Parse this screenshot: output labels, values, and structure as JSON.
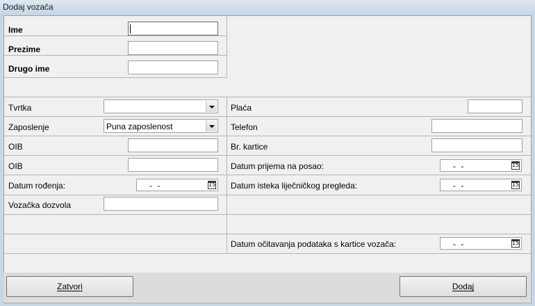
{
  "window": {
    "title": "Dodaj vozača"
  },
  "personal": {
    "ime_label": "Ime",
    "prezime_label": "Prezime",
    "drugo_ime_label": "Drugo ime",
    "ime_value": "",
    "prezime_value": "",
    "drugo_ime_value": ""
  },
  "left": {
    "tvrtka_label": "Tvrtka",
    "tvrtka_value": "",
    "zaposlenje_label": "Zaposlenje",
    "zaposlenje_value": "Puna zaposlenost",
    "oib1_label": "OIB",
    "oib2_label": "OIB",
    "datum_rodjenja_label": "Datum rođenja:",
    "datum_rodjenja_value": "- -",
    "vozacka_label": "Vozačka dozvola"
  },
  "right": {
    "placa_label": "Plaća",
    "telefon_label": "Telefon",
    "kartica_label": "Br. kartice",
    "prijem_label": "Datum prijema na posao:",
    "prijem_value": "- -",
    "lijecnicki_label": "Datum isteka liječničkog pregleda:",
    "lijecnicki_value": "- -",
    "ocitavanje_label": "Datum očitavanja podataka s kartice vozača:",
    "ocitavanje_value": "- -"
  },
  "calendar_icon_text": "15",
  "buttons": {
    "close": "Zatvori",
    "add": "Dodaj"
  }
}
